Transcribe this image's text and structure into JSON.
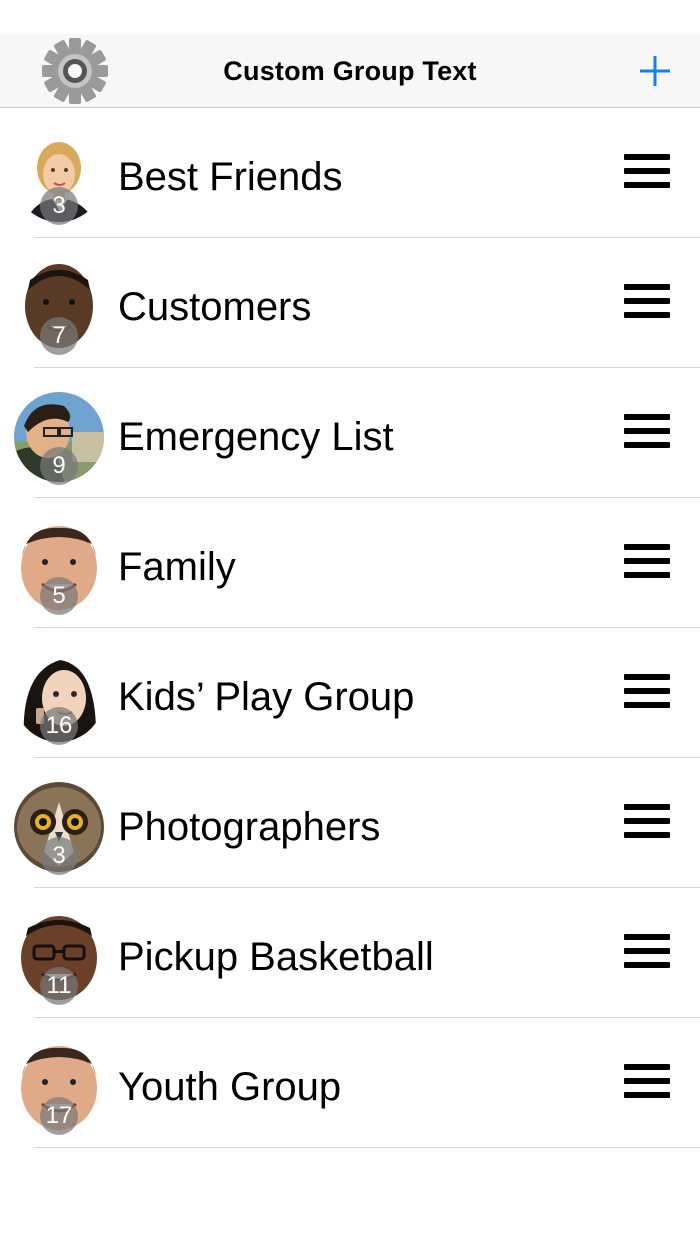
{
  "nav": {
    "title": "Custom Group Text",
    "settings_icon": "gear-icon",
    "add_icon": "plus-icon",
    "accent_color": "#1a7cf5"
  },
  "groups": [
    {
      "name": "Best Friends",
      "count": "3",
      "avatar": "woman-blonde"
    },
    {
      "name": "Customers",
      "count": "7",
      "avatar": "man-dark"
    },
    {
      "name": "Emergency List",
      "count": "9",
      "avatar": "man-glasses-outdoor"
    },
    {
      "name": "Family",
      "count": "5",
      "avatar": "man-smiling"
    },
    {
      "name": "Kids’ Play Group",
      "count": "16",
      "avatar": "woman-dark-hair"
    },
    {
      "name": "Photographers",
      "count": "3",
      "avatar": "owl"
    },
    {
      "name": "Pickup Basketball",
      "count": "11",
      "avatar": "man-glasses"
    },
    {
      "name": "Youth Group",
      "count": "17",
      "avatar": "man-smiling"
    }
  ]
}
